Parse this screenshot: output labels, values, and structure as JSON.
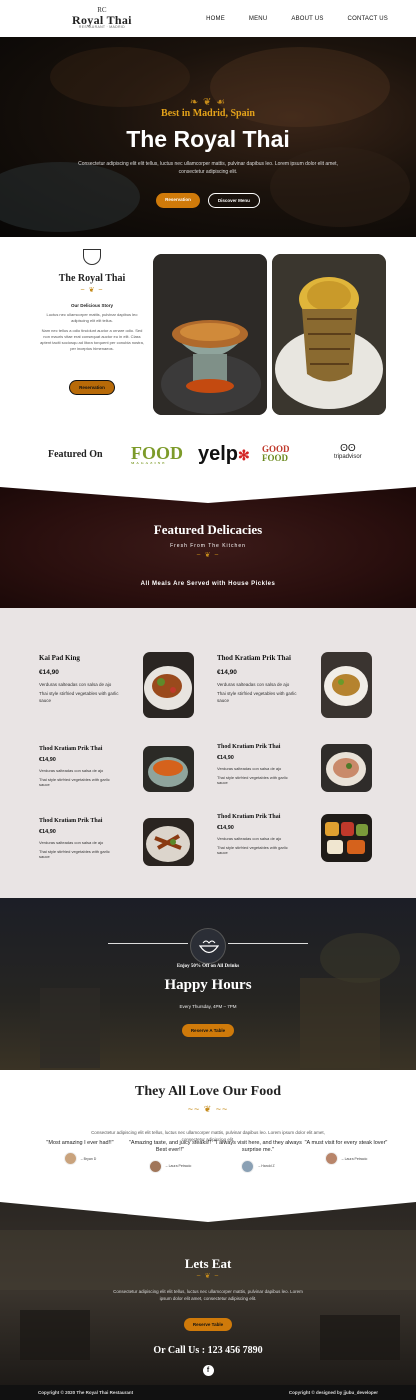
{
  "nav": {
    "logo_mark": "RC",
    "logo_title": "Royal Thai",
    "logo_tag": "RESTAURANT · MADRID",
    "items": [
      {
        "label": "HOME"
      },
      {
        "label": "MENU"
      },
      {
        "label": "ABOUT US"
      },
      {
        "label": "CONTACT US"
      }
    ]
  },
  "hero": {
    "kicker": "Best in Madrid, Spain",
    "title": "The Royal Thai",
    "lead": "Consectetur adipiscing elit elit tellus, luctus nec ullamcorper mattis, pulvinar dapibus leo. Lorem ipsum dolor elit amet, consectetur adipiscing elit.",
    "btn_primary": "Reservation",
    "btn_secondary": "Discover Menu"
  },
  "story": {
    "title": "The Royal Thai",
    "subtitle": "Our Delicious Story",
    "p1": "Luctus nec ullamcorper mattis, pulvinar dapibus leo adipiscing elit elit tellus.",
    "p2": "Nam nec tellus a odio tincidunt auctor a ornare odio. Sed non mauris vitae erat consequat auctor eu in elit. Class aptent taciti sociosqu ad litora torquent per conubia nostra, per inceptos himenaeos.",
    "btn": "Reservation"
  },
  "featured_on": {
    "title": "Featured On",
    "logos": [
      "FOOD",
      "MAGAZINE",
      "yelp",
      "GOOD",
      "FOOD",
      "tripadvisor"
    ]
  },
  "delicacies": {
    "title": "Featured Delicacies",
    "subtitle": "Fresh From The Kitchen",
    "note": "All Meals Are Served with House Pickles"
  },
  "menu_items": [
    {
      "name": "Kai Pad King",
      "price": "€14,90",
      "desc1": "Verduras salteadas con salsa de ajo",
      "desc2": "Thai style stirfried vegetables with garlic sauce"
    },
    {
      "name": "Thod Kratiam Prik Thai",
      "price": "€14,90",
      "desc1": "Verduras salteadas con salsa de ajo",
      "desc2": "Thai style stirfried vegetables with garlic sauce"
    },
    {
      "name": "Thod Kratiam Prik Thai",
      "price": "€14,90",
      "desc1": "Verduras salteadas con salsa de ajo",
      "desc2": "Thai style stirfried vegetables with garlic sauce"
    },
    {
      "name": "Thod Kratiam Prik Thai",
      "price": "€14,90",
      "desc1": "Verduras salteadas con salsa de ajo",
      "desc2": "Thai style stirfried vegetables with garlic sauce"
    },
    {
      "name": "Thod Kratiam Prik Thai",
      "price": "€14,90",
      "desc1": "Verduras salteadas con salsa de ajo",
      "desc2": "Thai style stirfried vegetables with garlic sauce"
    },
    {
      "name": "Thod Kratiam Prik Thai",
      "price": "€14,90",
      "desc1": "Verduras salteadas con salsa de ajo",
      "desc2": "Thai style stirfried vegetables with garlic sauce"
    }
  ],
  "happy": {
    "kicker": "Enjoy 50% Off on All Drinks",
    "title": "Happy Hours",
    "schedule": "Every Thursday, 4PM – 7PM",
    "btn": "Reserve A Table"
  },
  "love": {
    "title": "They All Love Our Food",
    "lead": "Consectetur adipiscing elit elit tellus, luctus nec ullamcorper mattis, pulvinar dapibus leo. Lorem ipsum dolor elit amet, consectetur adipiscing elit.",
    "reviews": [
      {
        "quote": "\"Most amazing I ever had!!\"",
        "author": "– Bryan D"
      },
      {
        "quote": "\"Amazing taste, and juicy steaks!! Best ever!!\"",
        "author": "– Laura Petracio"
      },
      {
        "quote": "\"I always visit here, and they always surprise me.\"",
        "author": "– Harold Z"
      },
      {
        "quote": "\"A must visit for every steak lover\"",
        "author": "– Laura Petracio"
      }
    ]
  },
  "eat": {
    "title": "Lets Eat",
    "lead": "Consectetur adipiscing elit elit tellus, luctus nec ullamcorper mattis, pulvinar dapibus leo. Lorem ipsum dolor elit amet, consectetur adipiscing elit.",
    "btn": "Reserve Table",
    "call": "Or Call Us : 123 456 7890",
    "social": "f"
  },
  "footer": {
    "left": "Copyright © 2020 The Royal Thai Restaurant",
    "right": "Copyright © designed by jjubu_developer"
  },
  "colors": {
    "accent": "#cf7a0a",
    "gold": "#e3a21a",
    "dark": "#1b0908",
    "menu_bg": "#e9e4e4"
  }
}
